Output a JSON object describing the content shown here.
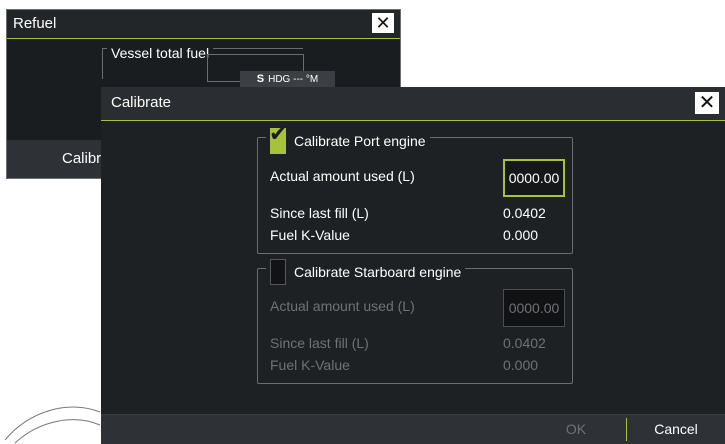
{
  "refuel": {
    "title": "Refuel",
    "close_symbol": "✕",
    "vessel_total_fuel_label": "Vessel total fuel",
    "calibrate_button": "Calibrate"
  },
  "status": {
    "hdg_prefix": "S",
    "hdg_text": "HDG --- °M"
  },
  "calibrate": {
    "title": "Calibrate",
    "close_symbol": "✕",
    "port": {
      "legend": "Calibrate Port engine",
      "checked": true,
      "actual_label": "Actual amount used (L)",
      "actual_value": "0000.00",
      "since_label": "Since last fill (L)",
      "since_value": "0.0402",
      "k_label": "Fuel K-Value",
      "k_value": "0.000"
    },
    "starboard": {
      "legend": "Calibrate Starboard engine",
      "checked": false,
      "actual_label": "Actual amount used (L)",
      "actual_value": "0000.00",
      "since_label": "Since last fill (L)",
      "since_value": "0.0402",
      "k_label": "Fuel K-Value",
      "k_value": "0.000"
    },
    "ok_label": "OK",
    "cancel_label": "Cancel"
  },
  "colors": {
    "accent": "#a5c23a",
    "dialog_bg": "#1e2124",
    "disabled_text": "#6e7276"
  }
}
